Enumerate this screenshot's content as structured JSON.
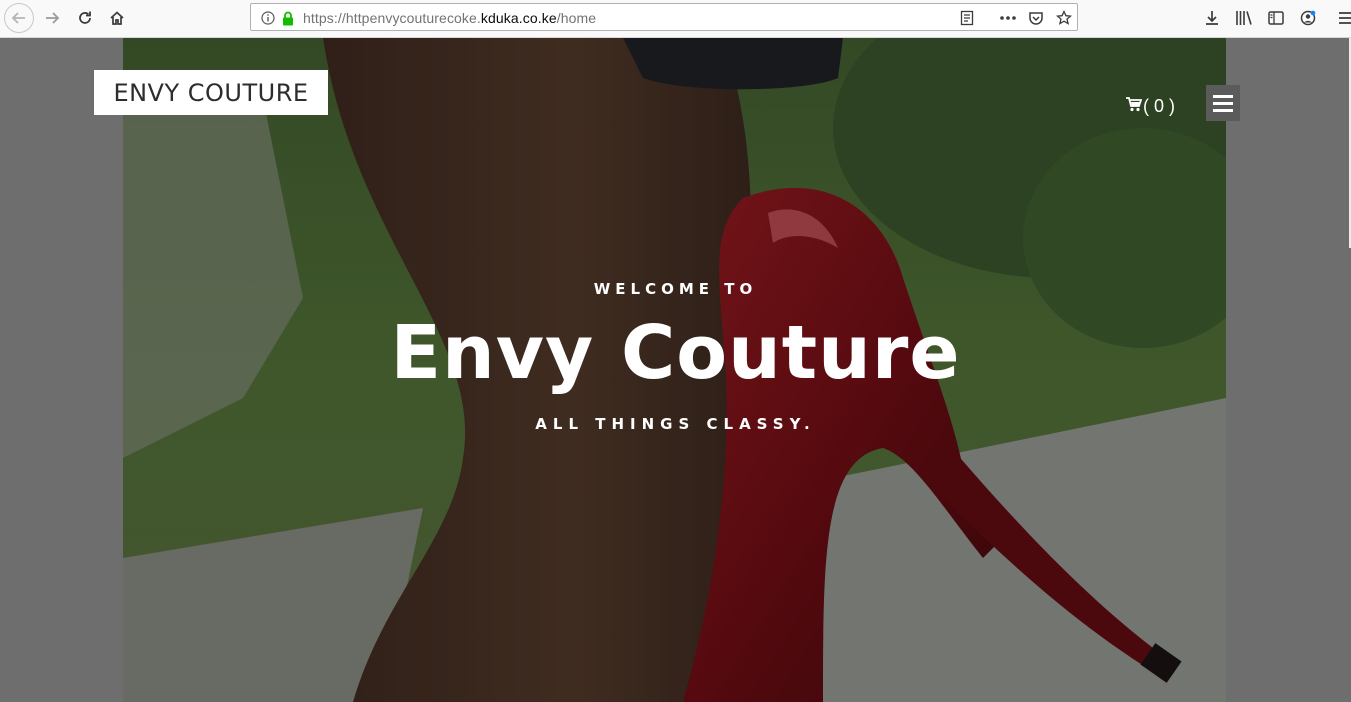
{
  "browser": {
    "url_prefix": "https://httpenvycouturecoke.",
    "url_domain": "kduka.co.ke",
    "url_path": "/home"
  },
  "site": {
    "logo_text": "ENVY COUTURE",
    "cart_count": "( 0 )"
  },
  "hero": {
    "welcome": "WELCOME TO",
    "title": "Envy Couture",
    "tagline": "ALL THINGS CLASSY."
  },
  "icons": {
    "back": "back-arrow-icon",
    "forward": "forward-arrow-icon",
    "reload": "reload-icon",
    "home": "home-icon",
    "info": "info-icon",
    "lock": "lock-icon",
    "reader": "reader-view-icon",
    "more": "more-icon",
    "pocket": "pocket-icon",
    "bookmark": "star-icon",
    "download": "download-icon",
    "library": "library-icon",
    "sidebar": "sidebar-icon",
    "account": "account-icon",
    "app_menu": "app-menu-icon",
    "cart": "cart-icon",
    "hamburger": "hamburger-icon"
  },
  "colors": {
    "page_bg": "#6e6e6e",
    "shoe": "#7a0f14",
    "secure_lock": "#12bc00"
  }
}
